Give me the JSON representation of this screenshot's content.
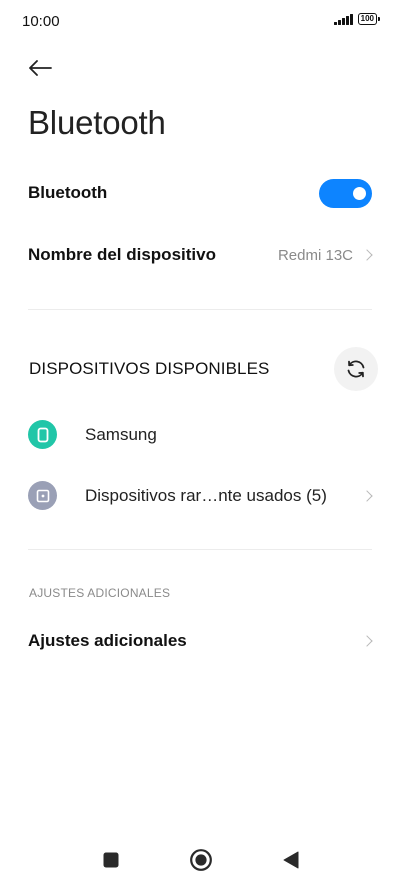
{
  "status_bar": {
    "time": "10:00",
    "battery": "100",
    "icons": [
      "signal-icon",
      "battery-icon"
    ]
  },
  "header": {
    "back_icon": "back-arrow-icon",
    "title": "Bluetooth"
  },
  "bluetooth_toggle": {
    "label": "Bluetooth",
    "on": true,
    "accent_color": "#0d84ff"
  },
  "device_name": {
    "label": "Nombre del dispositivo",
    "value": "Redmi 13C"
  },
  "available_devices": {
    "header": "DISPOSITIVOS DISPONIBLES",
    "refresh_icon": "refresh-icon",
    "items": [
      {
        "name": "Samsung",
        "icon": "phone-icon",
        "icon_color": "#21c6a8"
      },
      {
        "name": "Dispositivos rar…nte usados (5)",
        "icon": "device-icon",
        "icon_color": "#9aa0b6"
      }
    ]
  },
  "additional": {
    "subheader": "AJUSTES ADICIONALES",
    "item_label": "Ajustes adicionales"
  },
  "nav_bar": {
    "icons": [
      "recents-icon",
      "home-icon",
      "back-icon"
    ]
  }
}
